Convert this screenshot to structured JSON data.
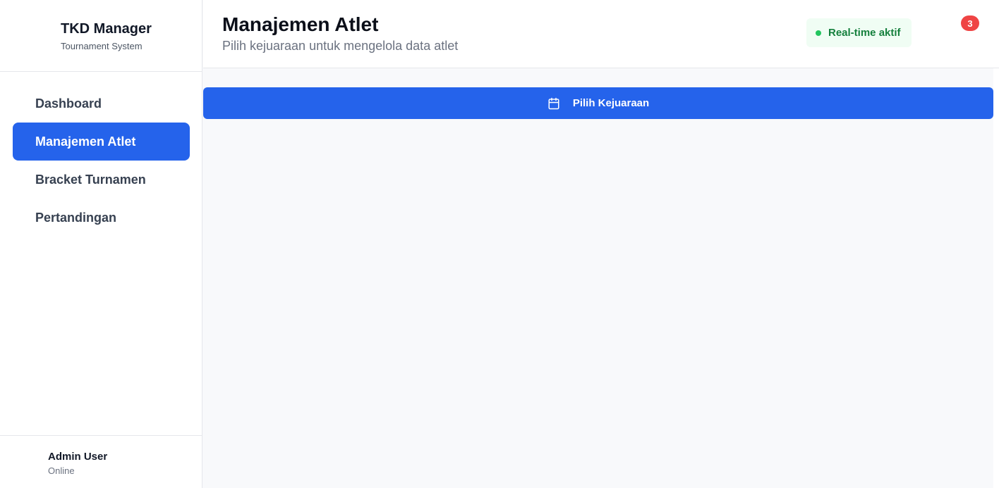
{
  "brand": {
    "title": "TKD Manager",
    "subtitle": "Tournament System"
  },
  "sidebar": {
    "items": [
      {
        "label": "Dashboard",
        "active": false
      },
      {
        "label": "Manajemen Atlet",
        "active": true
      },
      {
        "label": "Bracket Turnamen",
        "active": false
      },
      {
        "label": "Pertandingan",
        "active": false
      }
    ]
  },
  "user": {
    "name": "Admin User",
    "status": "Online"
  },
  "header": {
    "title": "Manajemen Atlet",
    "subtitle": "Pilih kejuaraan untuk mengelola data atlet",
    "realtime_label": "Real-time aktif",
    "notification_count": "3"
  },
  "main": {
    "pick_button_label": "Pilih Kejuaraan",
    "pick_button_icon": "calendar-icon"
  },
  "colors": {
    "primary": "#2563eb",
    "success_text": "#15803d",
    "success_dot": "#22c55e",
    "badge": "#ef4444"
  }
}
